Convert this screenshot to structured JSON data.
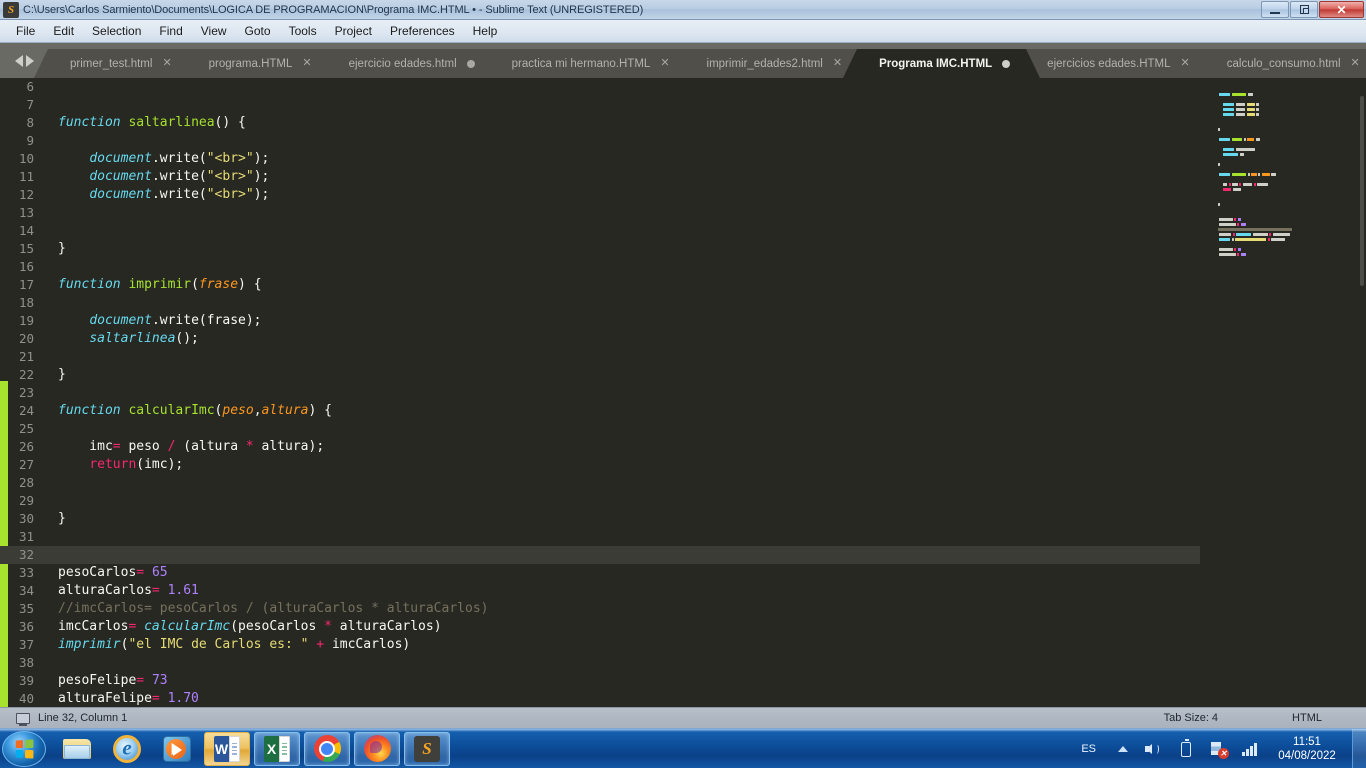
{
  "window": {
    "title": "C:\\Users\\Carlos Sarmiento\\Documents\\LOGICA DE PROGRAMACION\\Programa IMC.HTML • - Sublime Text (UNREGISTERED)",
    "app_icon": "S",
    "minimize_label": "Minimize",
    "restore_label": "Restore",
    "close_label": "✕"
  },
  "menubar": {
    "items": [
      {
        "label": "File"
      },
      {
        "label": "Edit"
      },
      {
        "label": "Selection"
      },
      {
        "label": "Find"
      },
      {
        "label": "View"
      },
      {
        "label": "Goto"
      },
      {
        "label": "Tools"
      },
      {
        "label": "Project"
      },
      {
        "label": "Preferences"
      },
      {
        "label": "Help"
      }
    ]
  },
  "tabs": {
    "items": [
      {
        "label": "primer_test.html",
        "active": false,
        "dirty": false,
        "close": "✕"
      },
      {
        "label": "programa.HTML",
        "active": false,
        "dirty": false,
        "close": "✕"
      },
      {
        "label": "ejercicio edades.html",
        "active": false,
        "dirty": true,
        "close": "✕"
      },
      {
        "label": "practica mi hermano.HTML",
        "active": false,
        "dirty": false,
        "close": "✕"
      },
      {
        "label": "imprimir_edades2.html",
        "active": false,
        "dirty": false,
        "close": "✕"
      },
      {
        "label": "Programa IMC.HTML",
        "active": true,
        "dirty": true,
        "close": "✕"
      },
      {
        "label": "ejercicios edades.HTML",
        "active": false,
        "dirty": false,
        "close": "✕"
      },
      {
        "label": "calculo_consumo.html",
        "active": false,
        "dirty": false,
        "close": "✕"
      }
    ]
  },
  "editor": {
    "first_line": 6,
    "cursor_line": 32,
    "lines": [
      {
        "n": 6,
        "tokens": []
      },
      {
        "n": 7,
        "tokens": []
      },
      {
        "n": 8,
        "tokens": [
          {
            "t": "function",
            "c": "t-kw"
          },
          {
            "t": " ",
            "c": "t-pl"
          },
          {
            "t": "saltarlinea",
            "c": "t-fn"
          },
          {
            "t": "() {",
            "c": "t-pl"
          }
        ]
      },
      {
        "n": 9,
        "tokens": []
      },
      {
        "n": 10,
        "tokens": [
          {
            "t": "    ",
            "c": "t-pl"
          },
          {
            "t": "document",
            "c": "t-ent"
          },
          {
            "t": ".write(",
            "c": "t-pl"
          },
          {
            "t": "\"<br>\"",
            "c": "t-str"
          },
          {
            "t": ");",
            "c": "t-pl"
          }
        ]
      },
      {
        "n": 11,
        "tokens": [
          {
            "t": "    ",
            "c": "t-pl"
          },
          {
            "t": "document",
            "c": "t-ent"
          },
          {
            "t": ".write(",
            "c": "t-pl"
          },
          {
            "t": "\"<br>\"",
            "c": "t-str"
          },
          {
            "t": ");",
            "c": "t-pl"
          }
        ]
      },
      {
        "n": 12,
        "tokens": [
          {
            "t": "    ",
            "c": "t-pl"
          },
          {
            "t": "document",
            "c": "t-ent"
          },
          {
            "t": ".write(",
            "c": "t-pl"
          },
          {
            "t": "\"<br>\"",
            "c": "t-str"
          },
          {
            "t": ");",
            "c": "t-pl"
          }
        ]
      },
      {
        "n": 13,
        "tokens": []
      },
      {
        "n": 14,
        "tokens": []
      },
      {
        "n": 15,
        "tokens": [
          {
            "t": "}",
            "c": "t-pl"
          }
        ]
      },
      {
        "n": 16,
        "tokens": []
      },
      {
        "n": 17,
        "tokens": [
          {
            "t": "function",
            "c": "t-kw"
          },
          {
            "t": " ",
            "c": "t-pl"
          },
          {
            "t": "imprimir",
            "c": "t-fn"
          },
          {
            "t": "(",
            "c": "t-pl"
          },
          {
            "t": "frase",
            "c": "t-par"
          },
          {
            "t": ") {",
            "c": "t-pl"
          }
        ]
      },
      {
        "n": 18,
        "tokens": []
      },
      {
        "n": 19,
        "tokens": [
          {
            "t": "    ",
            "c": "t-pl"
          },
          {
            "t": "document",
            "c": "t-ent"
          },
          {
            "t": ".write(frase);",
            "c": "t-pl"
          }
        ]
      },
      {
        "n": 20,
        "tokens": [
          {
            "t": "    ",
            "c": "t-pl"
          },
          {
            "t": "saltarlinea",
            "c": "t-ent"
          },
          {
            "t": "();",
            "c": "t-pl"
          }
        ]
      },
      {
        "n": 21,
        "tokens": []
      },
      {
        "n": 22,
        "tokens": [
          {
            "t": "}",
            "c": "t-pl"
          }
        ]
      },
      {
        "n": 23,
        "tokens": []
      },
      {
        "n": 24,
        "tokens": [
          {
            "t": "function",
            "c": "t-kw"
          },
          {
            "t": " ",
            "c": "t-pl"
          },
          {
            "t": "calcularImc",
            "c": "t-fn"
          },
          {
            "t": "(",
            "c": "t-pl"
          },
          {
            "t": "peso",
            "c": "t-par"
          },
          {
            "t": ",",
            "c": "t-pl"
          },
          {
            "t": "altura",
            "c": "t-par"
          },
          {
            "t": ") {",
            "c": "t-pl"
          }
        ]
      },
      {
        "n": 25,
        "tokens": []
      },
      {
        "n": 26,
        "tokens": [
          {
            "t": "    imc",
            "c": "t-pl"
          },
          {
            "t": "=",
            "c": "t-op"
          },
          {
            "t": " peso ",
            "c": "t-pl"
          },
          {
            "t": "/",
            "c": "t-op"
          },
          {
            "t": " (altura ",
            "c": "t-pl"
          },
          {
            "t": "*",
            "c": "t-op"
          },
          {
            "t": " altura);",
            "c": "t-pl"
          }
        ]
      },
      {
        "n": 27,
        "tokens": [
          {
            "t": "    ",
            "c": "t-pl"
          },
          {
            "t": "return",
            "c": "t-op"
          },
          {
            "t": "(imc);",
            "c": "t-pl"
          }
        ]
      },
      {
        "n": 28,
        "tokens": []
      },
      {
        "n": 29,
        "tokens": []
      },
      {
        "n": 30,
        "tokens": [
          {
            "t": "}",
            "c": "t-pl"
          }
        ]
      },
      {
        "n": 31,
        "tokens": []
      },
      {
        "n": 32,
        "tokens": []
      },
      {
        "n": 33,
        "tokens": [
          {
            "t": "pesoCarlos",
            "c": "t-pl"
          },
          {
            "t": "=",
            "c": "t-op"
          },
          {
            "t": " ",
            "c": "t-pl"
          },
          {
            "t": "65",
            "c": "t-num"
          }
        ]
      },
      {
        "n": 34,
        "tokens": [
          {
            "t": "alturaCarlos",
            "c": "t-pl"
          },
          {
            "t": "=",
            "c": "t-op"
          },
          {
            "t": " ",
            "c": "t-pl"
          },
          {
            "t": "1.61",
            "c": "t-num"
          }
        ]
      },
      {
        "n": 35,
        "tokens": [
          {
            "t": "//imcCarlos= pesoCarlos / (alturaCarlos * alturaCarlos)",
            "c": "t-cmt"
          }
        ]
      },
      {
        "n": 36,
        "tokens": [
          {
            "t": "imcCarlos",
            "c": "t-pl"
          },
          {
            "t": "=",
            "c": "t-op"
          },
          {
            "t": " ",
            "c": "t-pl"
          },
          {
            "t": "calcularImc",
            "c": "t-ent"
          },
          {
            "t": "(pesoCarlos ",
            "c": "t-pl"
          },
          {
            "t": "*",
            "c": "t-op"
          },
          {
            "t": " alturaCarlos)",
            "c": "t-pl"
          }
        ]
      },
      {
        "n": 37,
        "tokens": [
          {
            "t": "imprimir",
            "c": "t-ent"
          },
          {
            "t": "(",
            "c": "t-pl"
          },
          {
            "t": "\"el IMC de Carlos es: \"",
            "c": "t-str"
          },
          {
            "t": " ",
            "c": "t-pl"
          },
          {
            "t": "+",
            "c": "t-op"
          },
          {
            "t": " imcCarlos)",
            "c": "t-pl"
          }
        ]
      },
      {
        "n": 38,
        "tokens": []
      },
      {
        "n": 39,
        "tokens": [
          {
            "t": "pesoFelipe",
            "c": "t-pl"
          },
          {
            "t": "=",
            "c": "t-op"
          },
          {
            "t": " ",
            "c": "t-pl"
          },
          {
            "t": "73",
            "c": "t-num"
          }
        ]
      },
      {
        "n": 40,
        "tokens": [
          {
            "t": "alturaFelipe",
            "c": "t-pl"
          },
          {
            "t": "=",
            "c": "t-op"
          },
          {
            "t": " ",
            "c": "t-pl"
          },
          {
            "t": "1.70",
            "c": "t-num"
          }
        ]
      }
    ]
  },
  "statusbar": {
    "position": "Line 32, Column 1",
    "tab_size": "Tab Size: 4",
    "syntax": "HTML"
  },
  "taskbar": {
    "start_label": "Start",
    "buttons": [
      {
        "name": "windows-explorer",
        "label": "Windows Explorer",
        "state": "pinned"
      },
      {
        "name": "internet-explorer",
        "label": "Internet Explorer",
        "state": "pinned"
      },
      {
        "name": "windows-media-player",
        "label": "Windows Media Player",
        "state": "pinned"
      },
      {
        "name": "microsoft-word",
        "label": "W",
        "state": "active"
      },
      {
        "name": "microsoft-excel",
        "label": "X",
        "state": "running"
      },
      {
        "name": "google-chrome",
        "label": "Google Chrome",
        "state": "running"
      },
      {
        "name": "mozilla-firefox",
        "label": "Mozilla Firefox",
        "state": "running"
      },
      {
        "name": "sublime-text",
        "label": "S",
        "state": "running"
      }
    ],
    "tray": {
      "language": "ES",
      "time": "11:51",
      "date": "04/08/2022"
    }
  },
  "colors": {
    "accent_green": "#a6e22e",
    "editor_bg": "#272822",
    "keyword": "#66d9ef",
    "string": "#e6db74",
    "number": "#ae81ff",
    "operator": "#f92672",
    "comment": "#75715e",
    "parameter": "#fd971f",
    "taskbar_blue": "#0d4f9c"
  }
}
